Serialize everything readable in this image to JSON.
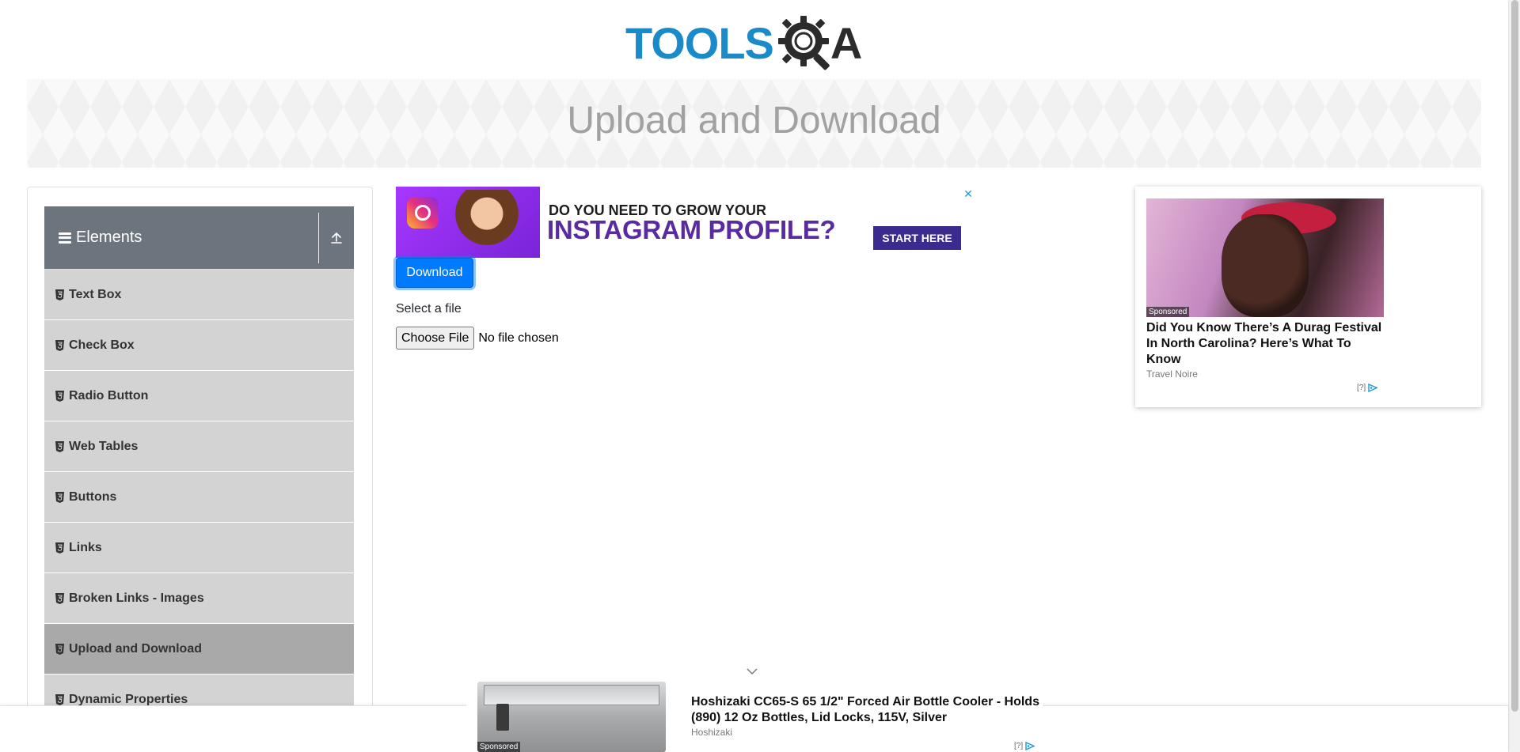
{
  "header": {
    "logo_text": "TOOLS",
    "logo_suffix": "A",
    "page_title": "Upload and Download"
  },
  "sidebar": {
    "group_title": "Elements",
    "items": [
      {
        "label": "Text Box",
        "active": false
      },
      {
        "label": "Check Box",
        "active": false
      },
      {
        "label": "Radio Button",
        "active": false
      },
      {
        "label": "Web Tables",
        "active": false
      },
      {
        "label": "Buttons",
        "active": false
      },
      {
        "label": "Links",
        "active": false
      },
      {
        "label": "Broken Links - Images",
        "active": false
      },
      {
        "label": "Upload and Download",
        "active": true
      },
      {
        "label": "Dynamic Properties",
        "active": false
      }
    ]
  },
  "main": {
    "download_label": "Download",
    "select_file_label": "Select a file",
    "choose_file_label": "Choose File",
    "file_status": "No file chosen"
  },
  "ads": {
    "top": {
      "line1": "DO YOU NEED TO GROW YOUR",
      "line2": "INSTAGRAM PROFILE?",
      "cta": "START HERE",
      "close": "✕"
    },
    "right": {
      "sponsored": "Sponsored",
      "title": "Did You Know There’s A Durag Festival In North Carolina? Here’s What To Know",
      "source": "Travel Noire",
      "adchoice": "[?]"
    },
    "bottom": {
      "sponsored": "Sponsored",
      "title": "Hoshizaki CC65-S 65 1/2\" Forced Air Bottle Cooler - Holds (890) 12 Oz Bottles, Lid Locks, 115V, Silver",
      "source": "Hoshizaki",
      "adchoice": "[?]"
    }
  },
  "colors": {
    "accent": "#007bff",
    "sidebar_header": "#6c757d",
    "menu_item": "#d3d3d3",
    "menu_item_active": "#a9a9a9",
    "logo_blue": "#1a8ac8"
  }
}
